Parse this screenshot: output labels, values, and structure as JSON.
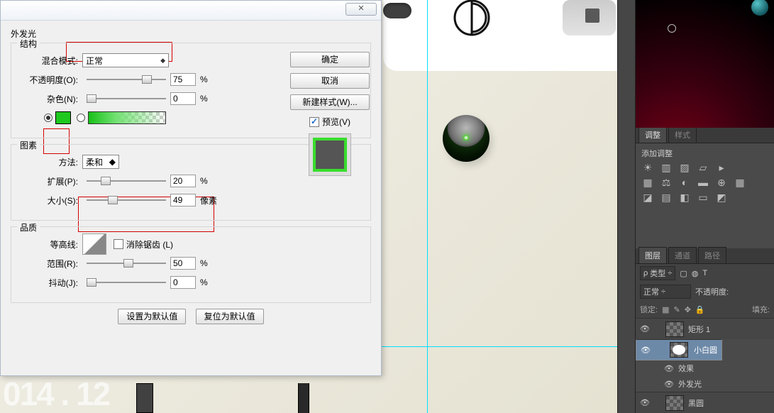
{
  "dialog": {
    "close": "✕",
    "title": "外发光",
    "struct": {
      "legend": "结构",
      "blend_label": "混合模式:",
      "blend_value": "正常",
      "opacity_label": "不透明度(O):",
      "opacity_value": "75",
      "opacity_unit": "%",
      "noise_label": "杂色(N):",
      "noise_value": "0",
      "noise_unit": "%",
      "swatch_color": "#1ec81e"
    },
    "elem": {
      "legend": "图素",
      "method_label": "方法:",
      "method_value": "柔和",
      "spread_label": "扩展(P):",
      "spread_value": "20",
      "spread_unit": "%",
      "size_label": "大小(S):",
      "size_value": "49",
      "size_unit": "像素"
    },
    "qual": {
      "legend": "品质",
      "contour_label": "等高线:",
      "aa_label": "消除锯齿 (L)",
      "range_label": "范围(R):",
      "range_value": "50",
      "range_unit": "%",
      "jitter_label": "抖动(J):",
      "jitter_value": "0",
      "jitter_unit": "%"
    },
    "footer": {
      "set_default": "设置为默认值",
      "reset_default": "复位为默认值"
    },
    "side": {
      "ok": "确定",
      "cancel": "取消",
      "new_style": "新建样式(W)...",
      "preview": "预览(V)"
    }
  },
  "panel": {
    "adjust_tabs": {
      "a": "调整",
      "b": "样式"
    },
    "adjust_title": "添加调整",
    "layer_tabs": {
      "a": "图层",
      "b": "通道",
      "c": "路径"
    },
    "filter_label": "类型",
    "mode_value": "正常",
    "opacity_label": "不透明度:",
    "lock_label": "锁定:",
    "fill_label": "填充:",
    "layers": {
      "l1": "矩形 1",
      "l2": "小白圆",
      "l2a": "效果",
      "l2b": "外发光",
      "l3": "黑圆"
    }
  },
  "stamp": "014 . 12"
}
